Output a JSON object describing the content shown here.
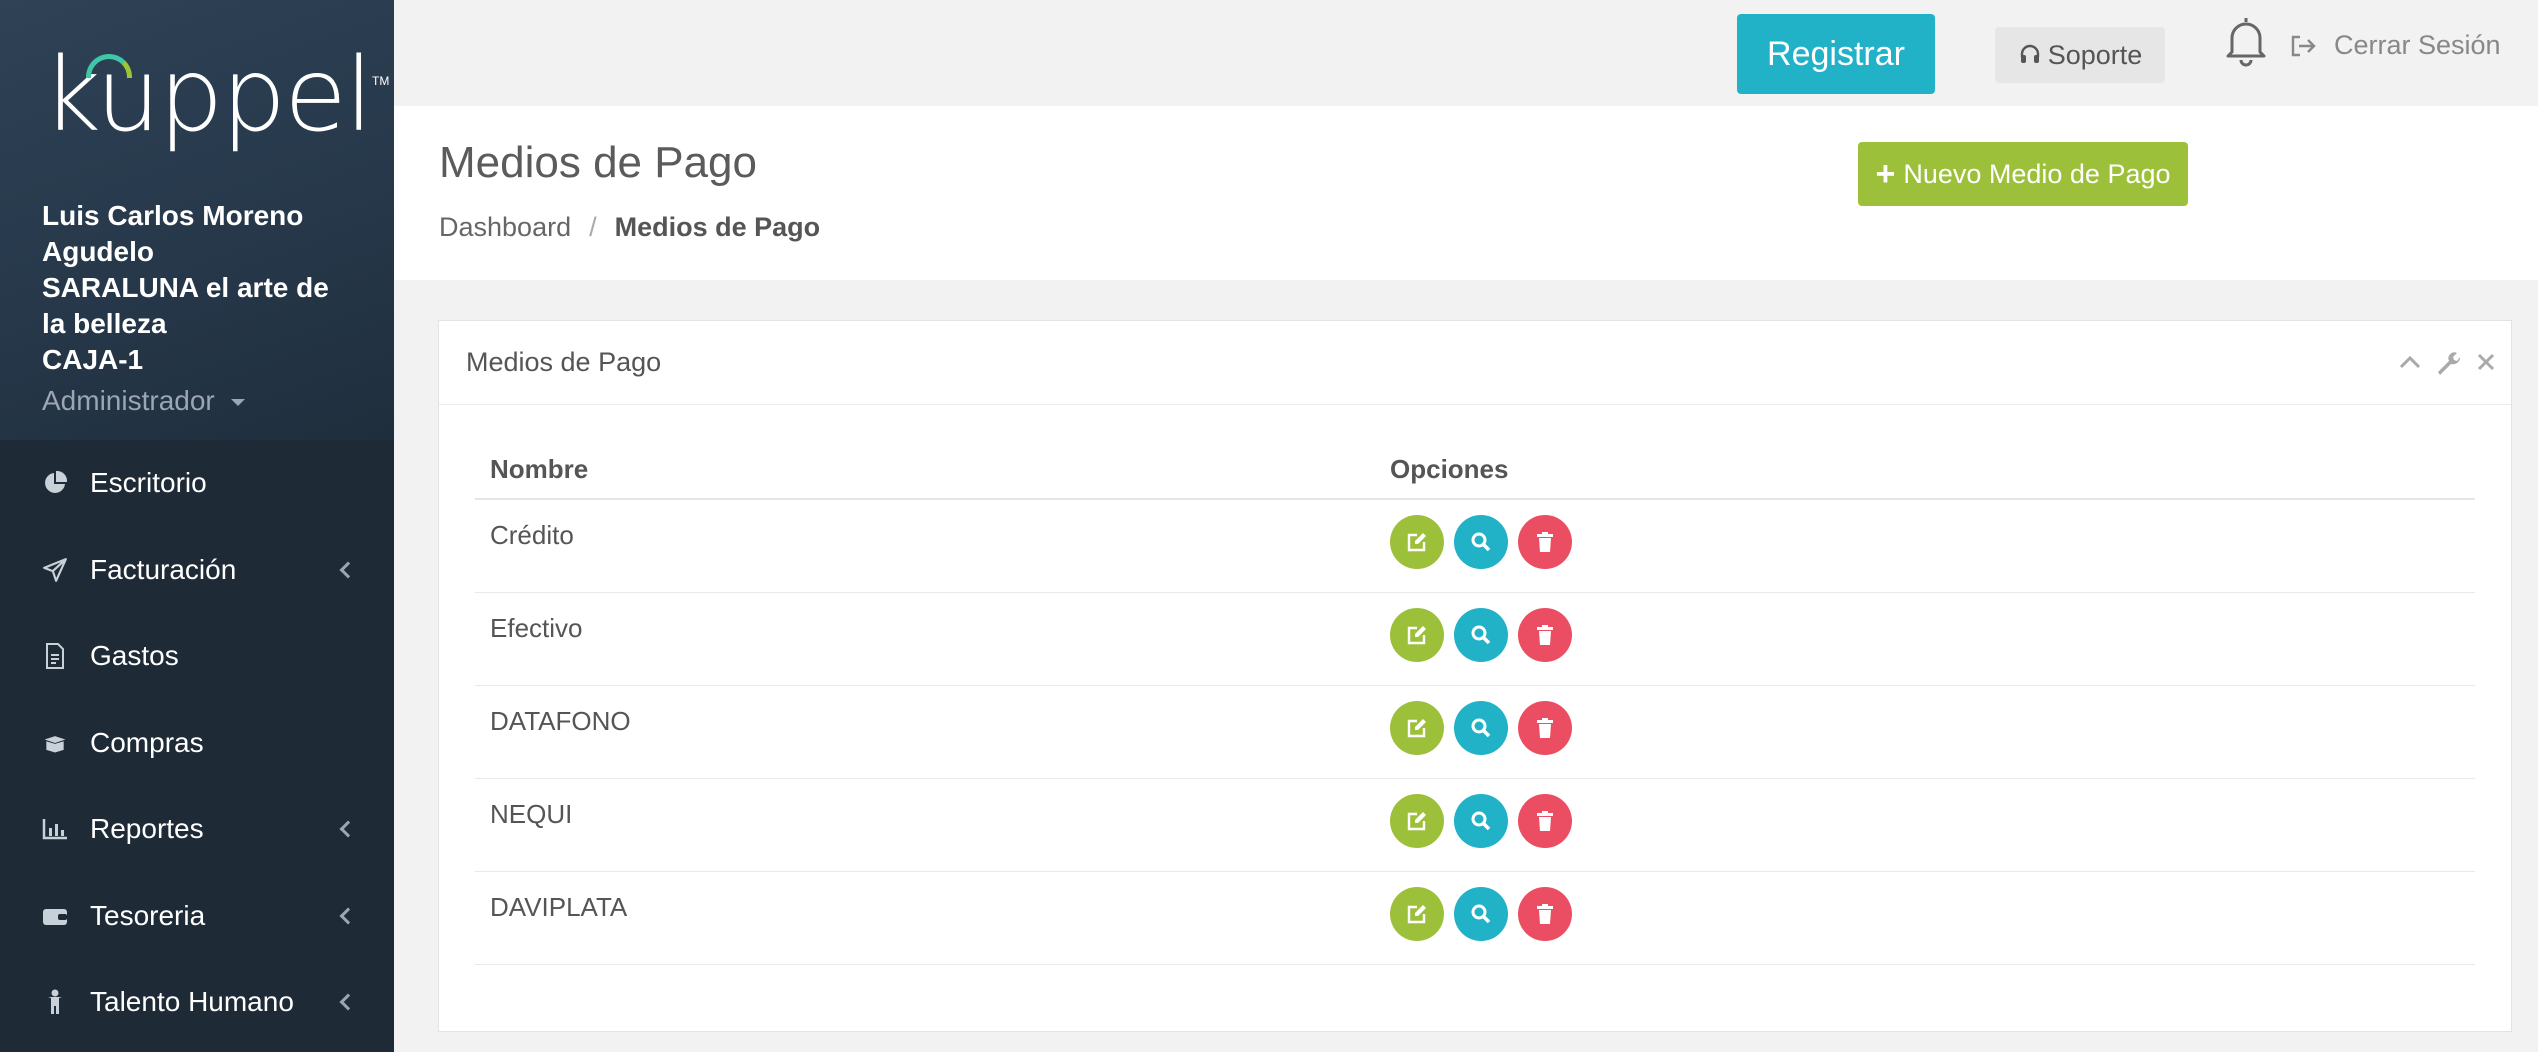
{
  "sidebar": {
    "logo": "kuppel",
    "logo_tm": "TM",
    "user": {
      "name_line1": "Luis Carlos Moreno",
      "name_line2": "Agudelo",
      "company_line1": "SARALUNA el arte de",
      "company_line2": "la belleza",
      "register": "CAJA-1",
      "role": "Administrador"
    },
    "items": [
      {
        "label": "Escritorio",
        "icon": "pie-chart-icon",
        "has_submenu": false
      },
      {
        "label": "Facturación",
        "icon": "paper-plane-icon",
        "has_submenu": true
      },
      {
        "label": "Gastos",
        "icon": "file-invoice-icon",
        "has_submenu": false
      },
      {
        "label": "Compras",
        "icon": "box-open-icon",
        "has_submenu": false
      },
      {
        "label": "Reportes",
        "icon": "bar-chart-icon",
        "has_submenu": true
      },
      {
        "label": "Tesoreria",
        "icon": "wallet-icon",
        "has_submenu": true
      },
      {
        "label": "Talento Humano",
        "icon": "person-icon",
        "has_submenu": true
      }
    ]
  },
  "topbar": {
    "registrar": "Registrar",
    "soporte": "Soporte",
    "logout": "Cerrar Sesión"
  },
  "page": {
    "title": "Medios de Pago",
    "breadcrumb": {
      "home": "Dashboard",
      "separator": "/",
      "current": "Medios de Pago"
    },
    "new_button": "Nuevo Medio de Pago"
  },
  "panel": {
    "title": "Medios de Pago",
    "table": {
      "headers": [
        "Nombre",
        "Opciones"
      ],
      "rows": [
        "Crédito",
        "Efectivo",
        "DATAFONO",
        "NEQUI",
        "DAVIPLATA"
      ]
    }
  },
  "colors": {
    "sidebar": "#1e2a36",
    "primary": "#22b2c8",
    "success": "#9dc03b",
    "danger": "#eb4e62"
  }
}
